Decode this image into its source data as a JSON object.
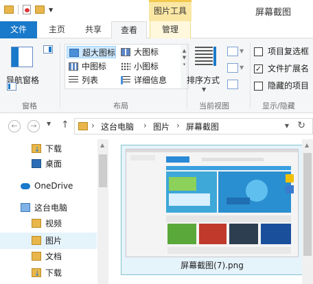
{
  "window": {
    "title": "屏幕截图",
    "contextual_group": "图片工具"
  },
  "tabs": {
    "file": "文件",
    "home": "主页",
    "share": "共享",
    "view": "查看",
    "manage": "管理"
  },
  "ribbon": {
    "panes": {
      "nav_pane_label": "导航窗格",
      "group_label": "窗格"
    },
    "layout": {
      "group_label": "布局",
      "extra_large": "超大图标",
      "large": "大图标",
      "medium": "中图标",
      "small": "小图标",
      "list": "列表",
      "details": "详细信息"
    },
    "current_view": {
      "sort_label": "排序方式",
      "group_label": "当前视图"
    },
    "show_hide": {
      "group_label": "显示/隐藏",
      "item_checkboxes": "项目复选框",
      "item_checkboxes_checked": false,
      "file_extensions": "文件扩展名",
      "file_extensions_checked": true,
      "hidden_items": "隐藏的项目",
      "hidden_items_checked": false
    }
  },
  "address": {
    "crumbs": [
      "这台电脑",
      "图片",
      "屏幕截图"
    ]
  },
  "nav_pane": {
    "items": [
      {
        "label": "下载",
        "icon": "download-folder-icon"
      },
      {
        "label": "桌面",
        "icon": "desktop-icon"
      },
      {
        "label": "OneDrive",
        "icon": "onedrive-icon"
      },
      {
        "label": "这台电脑",
        "icon": "this-pc-icon"
      },
      {
        "label": "视频",
        "icon": "videos-folder-icon"
      },
      {
        "label": "图片",
        "icon": "pictures-folder-icon",
        "selected": true
      },
      {
        "label": "文档",
        "icon": "documents-folder-icon"
      },
      {
        "label": "下载",
        "icon": "download-folder-icon"
      }
    ]
  },
  "files": [
    {
      "name": "屏幕截图(7).png"
    }
  ]
}
